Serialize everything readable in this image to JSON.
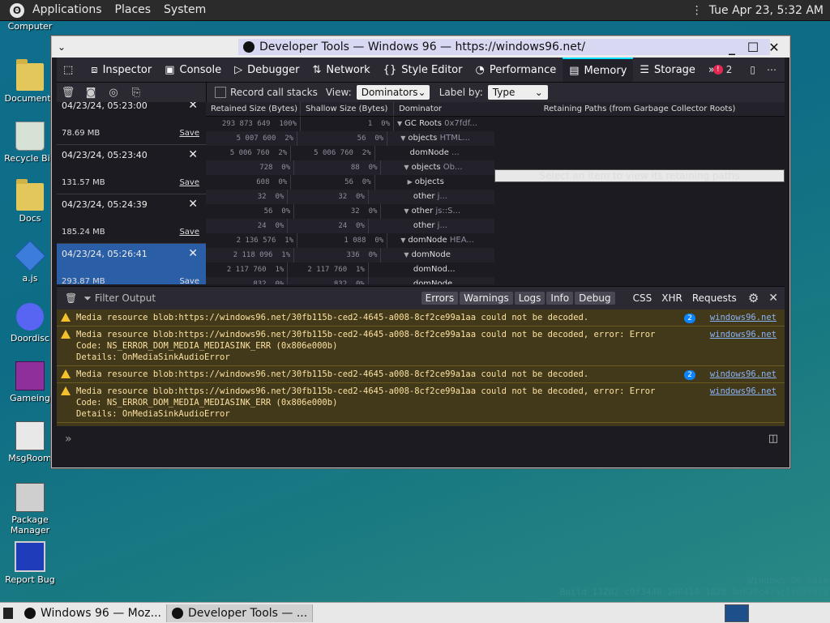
{
  "top_panel": {
    "menus": [
      "Applications",
      "Places",
      "System"
    ],
    "clock": "Tue Apr 23, 5:32 AM"
  },
  "desktop_icons": [
    {
      "label": "Computer"
    },
    {
      "label": "Documents"
    },
    {
      "label": "Recycle Bin"
    },
    {
      "label": "Docs"
    },
    {
      "label": "a.js"
    },
    {
      "label": "Doordisc"
    },
    {
      "label": "Gameing"
    },
    {
      "label": "MsgRoom"
    },
    {
      "label": "Package Manager"
    },
    {
      "label": "Report Bug"
    }
  ],
  "window": {
    "title": "Developer Tools — Windows 96 — https://windows96.net/"
  },
  "devtools_tabs": [
    {
      "label": "Inspector",
      "icon": "inspector-icon"
    },
    {
      "label": "Console",
      "icon": "console-icon"
    },
    {
      "label": "Debugger",
      "icon": "debugger-icon"
    },
    {
      "label": "Network",
      "icon": "network-icon"
    },
    {
      "label": "Style Editor",
      "icon": "braces-icon"
    },
    {
      "label": "Performance",
      "icon": "performance-icon"
    },
    {
      "label": "Memory",
      "icon": "memory-icon",
      "active": true
    },
    {
      "label": "Storage",
      "icon": "storage-icon"
    }
  ],
  "error_count": "2",
  "memory": {
    "record_call_stacks": "Record call stacks",
    "view_label": "View:",
    "view_value": "Dominators",
    "label_by_label": "Label by:",
    "label_by_value": "Type",
    "snapshots": [
      {
        "date": "04/23/24, 05:23:00",
        "size": "78.69 MB",
        "save": "Save"
      },
      {
        "date": "04/23/24, 05:23:40",
        "size": "131.57 MB",
        "save": "Save"
      },
      {
        "date": "04/23/24, 05:24:39",
        "size": "185.24 MB",
        "save": "Save"
      },
      {
        "date": "04/23/24, 05:26:41",
        "size": "293.87 MB",
        "save": "Save",
        "selected": true
      }
    ],
    "columns": [
      "Retained Size (Bytes)",
      "Shallow Size (Bytes)",
      "Dominator",
      "Retaining Paths (from Garbage Collector Roots)"
    ],
    "rows": [
      {
        "retained": "293 873 649",
        "rpct": "100%",
        "shallow": "1",
        "spct": "0%",
        "node": "GC Roots",
        "extra": "0x7fdf...",
        "indent": 0,
        "tri": "▼"
      },
      {
        "retained": "5 007 600",
        "rpct": "2%",
        "shallow": "56",
        "spct": "0%",
        "node": "objects",
        "extra": "HTML...",
        "indent": 1,
        "tri": "▼"
      },
      {
        "retained": "5 006 760",
        "rpct": "2%",
        "shallow": "5 006 760",
        "spct": "2%",
        "node": "domNode",
        "extra": "...",
        "indent": 3,
        "tri": ""
      },
      {
        "retained": "728",
        "rpct": "0%",
        "shallow": "88",
        "spct": "0%",
        "node": "objects",
        "extra": "Ob...",
        "indent": 2,
        "tri": "▼"
      },
      {
        "retained": "608",
        "rpct": "0%",
        "shallow": "56",
        "spct": "0%",
        "node": "objects",
        "extra": "",
        "indent": 3,
        "tri": "▶"
      },
      {
        "retained": "32",
        "rpct": "0%",
        "shallow": "32",
        "spct": "0%",
        "node": "other",
        "extra": "j...",
        "indent": 4,
        "tri": ""
      },
      {
        "retained": "56",
        "rpct": "0%",
        "shallow": "32",
        "spct": "0%",
        "node": "other",
        "extra": "js::S...",
        "indent": 2,
        "tri": "▼"
      },
      {
        "retained": "24",
        "rpct": "0%",
        "shallow": "24",
        "spct": "0%",
        "node": "other",
        "extra": "j...",
        "indent": 4,
        "tri": ""
      },
      {
        "retained": "2 136 576",
        "rpct": "1%",
        "shallow": "1 088",
        "spct": "0%",
        "node": "domNode",
        "extra": "HEA...",
        "indent": 1,
        "tri": "▼"
      },
      {
        "retained": "2 118 096",
        "rpct": "1%",
        "shallow": "336",
        "spct": "0%",
        "node": "domNode",
        "extra": "",
        "indent": 2,
        "tri": "▼"
      },
      {
        "retained": "2 117 760",
        "rpct": "1%",
        "shallow": "2 117 760",
        "spct": "1%",
        "node": "domNod...",
        "extra": "",
        "indent": 4,
        "tri": ""
      },
      {
        "retained": "832",
        "rpct": "0%",
        "shallow": "832",
        "spct": "0%",
        "node": "domNode",
        "extra": "",
        "indent": 4,
        "tri": ""
      }
    ],
    "retaining_hint": "Select an item to view its retaining paths"
  },
  "console": {
    "filter_placeholder": "Filter Output",
    "filters": [
      {
        "label": "Errors",
        "on": true
      },
      {
        "label": "Warnings",
        "on": true
      },
      {
        "label": "Logs",
        "on": true
      },
      {
        "label": "Info",
        "on": true
      },
      {
        "label": "Debug",
        "on": true
      },
      {
        "label": "CSS",
        "on": false
      },
      {
        "label": "XHR",
        "on": false
      },
      {
        "label": "Requests",
        "on": false
      }
    ],
    "messages": [
      {
        "text": "Media resource blob:https://windows96.net/30fb115b-ced2-4645-a008-8cf2ce99a1aa could not be decoded.",
        "count": "2",
        "source": "windows96.net"
      },
      {
        "text": "Media resource blob:https://windows96.net/30fb115b-ced2-4645-a008-8cf2ce99a1aa could not be decoded, error: Error\nCode: NS_ERROR_DOM_MEDIA_MEDIASINK_ERR (0x806e000b)\nDetails: OnMediaSinkAudioError",
        "count": "",
        "source": "windows96.net"
      },
      {
        "text": "Media resource blob:https://windows96.net/30fb115b-ced2-4645-a008-8cf2ce99a1aa could not be decoded.",
        "count": "2",
        "source": "windows96.net"
      },
      {
        "text": "Media resource blob:https://windows96.net/30fb115b-ced2-4645-a008-8cf2ce99a1aa could not be decoded, error: Error\nCode: NS_ERROR_DOM_MEDIA_MEDIASINK_ERR (0x806e000b)\nDetails: OnMediaSinkAudioError",
        "count": "",
        "source": "windows96.net"
      }
    ]
  },
  "taskbar": {
    "items": [
      {
        "label": "Windows 96 — Moz..."
      },
      {
        "label": "Developer Tools — ..."
      }
    ]
  },
  "build_text": [
    "Windows 96 main",
    "Build 13202 c9f3448.240418-1828 0a630c474c1f0a7975"
  ]
}
